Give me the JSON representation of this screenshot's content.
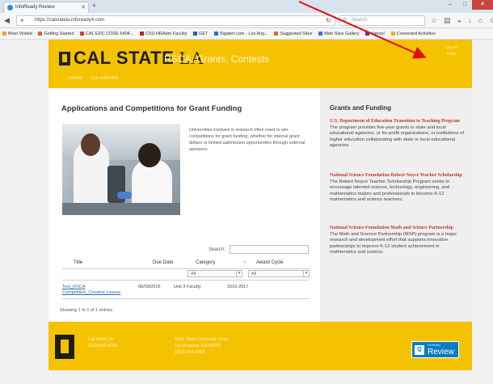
{
  "browser": {
    "tab_title": "InfoReady Review",
    "url": "https://calstatela.infoready4.com",
    "search_placeholder": "Search",
    "bookmarks": [
      "Most Visited",
      "Getting Started",
      "CAL EDC CODE 5404...",
      "CSU HRAdm Faculty",
      "GET",
      "Sigalert.com - Los Ang...",
      "Suggested Sites",
      "Web Slice Gallery",
      "Yahoo!",
      "Converted Activities"
    ],
    "colors": {
      "accent": "#2d8be0"
    }
  },
  "header": {
    "logo": "CAL STATE",
    "logo_la": "LA",
    "site_title": "RSCA, Grants, Contests",
    "login": [
      "Log in",
      "Help"
    ],
    "nav": [
      "HOME",
      "CALENDAR"
    ],
    "colors": {
      "gold": "#f5c200"
    }
  },
  "main": {
    "heading": "Applications and Competitions for Grant Funding",
    "intro": "Universities involved in research often need to win competitions for grant funding, whether for internal grant dollars or limited submission opportunities through external sponsors.",
    "search_label": "Search:",
    "table": {
      "columns": [
        "Title",
        "Due Date",
        "Category",
        "Award Cycle"
      ],
      "filters": [
        "All",
        "All"
      ],
      "rows": [
        {
          "title": "Test_RSCA Competition_Creative Leaves",
          "due_date": "06/09/2016",
          "category": "Unit 3 Faculty",
          "award_cycle": "2016-2017"
        }
      ]
    },
    "showing": "Showing 1 to 1 of 1 entries"
  },
  "sidebar": {
    "heading": "Grants and Funding",
    "items": [
      {
        "title": "U.S. Department of Education Transition to Teaching Program",
        "desc": "The program provides five-year grants to state and local educational agencies, or for-profit organizations, or institutions of higher education collaborating with state or local educational agencies."
      },
      {
        "title": "National Science Foundation Robert Noyce Teacher Scholarship",
        "desc": "The Robert Noyce Teacher Scholarship Program seeks to encourage talented science, technology, engineering, and mathematics majors and professionals to become K-12 mathematics and science teachers."
      },
      {
        "title": "National Science Foundation Math and Science Partnership",
        "desc": "The Math and Science Partnership (MSP) program is a major research and development effort that supports innovative partnerships to improve K-12 student achievement in mathematics and science."
      }
    ]
  },
  "footer": {
    "org": [
      "Cal State LA",
      "(323)343-5000"
    ],
    "address": [
      "5151 State University Drive",
      "Los Angeles, CA 90032",
      "(323) 343-3000"
    ],
    "badge_sub": "InfoReady",
    "badge": "Review"
  }
}
